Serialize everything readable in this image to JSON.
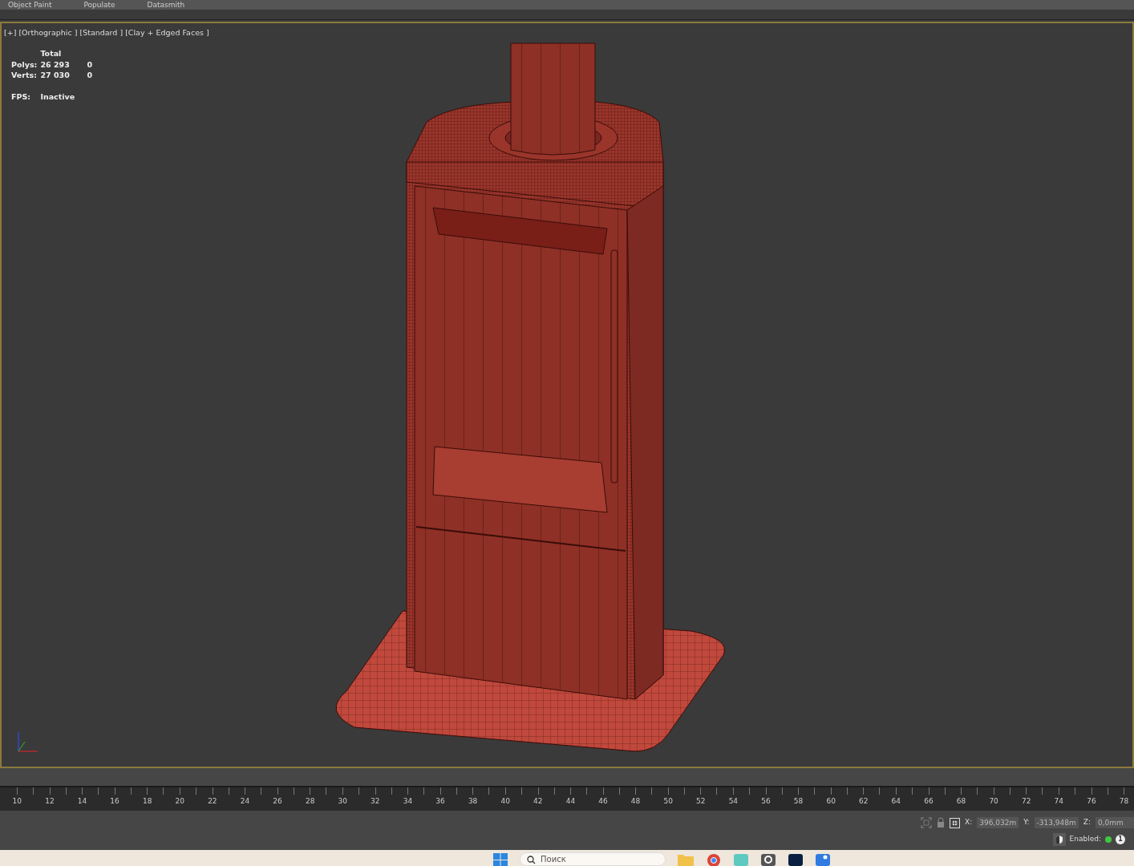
{
  "menu": [
    "Object Paint",
    "Populate",
    "Datasmith"
  ],
  "viewport": {
    "label": "[+] [Orthographic ] [Standard ] [Clay + Edged Faces ]",
    "stats": {
      "header": "Total",
      "rows": [
        {
          "label": "Polys:",
          "total": "26 293",
          "selection": "0"
        },
        {
          "label": "Verts:",
          "total": "27 030",
          "selection": "0"
        }
      ]
    },
    "fps": {
      "label": "FPS:",
      "value": "Inactive"
    }
  },
  "timeline": {
    "ticks": [
      "10",
      "12",
      "14",
      "16",
      "18",
      "20",
      "22",
      "24",
      "26",
      "28",
      "30",
      "32",
      "34",
      "36",
      "38",
      "40",
      "42",
      "44",
      "46",
      "48",
      "50",
      "52",
      "54",
      "56",
      "58",
      "60",
      "62",
      "64",
      "66",
      "68",
      "70",
      "72",
      "74",
      "76",
      "78"
    ]
  },
  "status": {
    "coords": [
      {
        "axis": "X:",
        "value": "396,032m"
      },
      {
        "axis": "Y:",
        "value": "-313,948m"
      },
      {
        "axis": "Z:",
        "value": "0,0mm"
      }
    ],
    "enabled_label": "Enabled:",
    "enabled": true,
    "badge": "1"
  },
  "taskbar": {
    "search_placeholder": "Поиск"
  }
}
